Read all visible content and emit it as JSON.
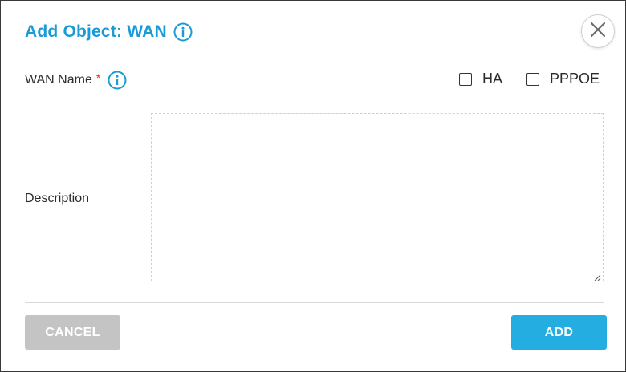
{
  "dialog": {
    "title": "Add Object: WAN",
    "icons": {
      "title_info": "info-icon",
      "close": "close-icon",
      "name_info": "info-icon"
    }
  },
  "form": {
    "wan_name": {
      "label": "WAN Name",
      "required_marker": "*",
      "value": "",
      "placeholder": ""
    },
    "ha": {
      "label": "HA",
      "checked": false
    },
    "pppoe": {
      "label": "PPPOE",
      "checked": false
    },
    "description": {
      "label": "Description",
      "value": ""
    }
  },
  "actions": {
    "cancel_label": "CANCEL",
    "add_label": "ADD"
  },
  "colors": {
    "accent": "#1a9ad6",
    "primary_button": "#23ade0",
    "disabled_button": "#c4c4c4",
    "required": "#d93025"
  }
}
